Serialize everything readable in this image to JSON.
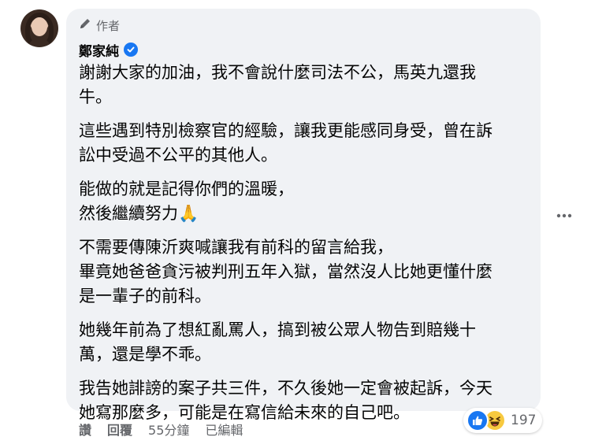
{
  "comment": {
    "author_badge": "作者",
    "author_name": "鄭家純",
    "paragraphs": [
      [
        "謝謝大家的加油，我不會說什麼司法不公，馬英九還我",
        "牛。"
      ],
      [
        "這些遇到特別檢察官的經驗，讓我更能感同身受，曾在訴",
        "訟中受過不公平的其他人。"
      ],
      [
        "能做的就是記得你們的溫暖，",
        "然後繼續努力🙏"
      ],
      [
        "不需要傳陳沂爽喊讓我有前科的留言給我，",
        "畢竟她爸爸貪污被判刑五年入獄，當然沒人比她更懂什麼",
        "是一輩子的前科。"
      ],
      [
        "她幾年前為了想紅亂罵人，搞到被公眾人物告到賠幾十",
        "萬，還是學不乖。"
      ],
      [
        "我告她誹謗的案子共三件，不久後她一定會被起訴，今天",
        "她寫那麼多，可能是在寫信給未來的自己吧。"
      ]
    ],
    "reaction_count": "197",
    "reaction_icons": [
      "like-icon",
      "haha-icon"
    ]
  },
  "actions": {
    "like": "讚",
    "reply": "回覆",
    "time": "55分鐘",
    "edited": "已編輯"
  },
  "colors": {
    "bubble": "#f0f2f5",
    "meta_text": "#65676b",
    "like_blue": "#1877f2",
    "haha_yellow": "#f7c93f"
  }
}
